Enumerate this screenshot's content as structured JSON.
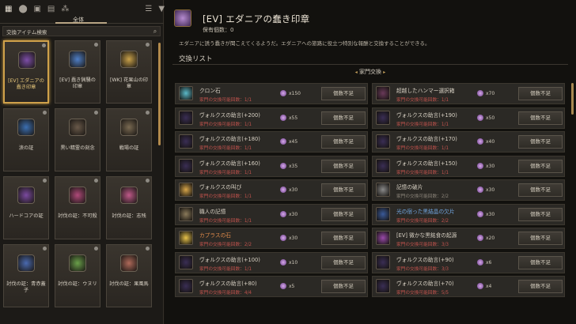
{
  "nav": {
    "icons": [
      "grid-icon",
      "pin-icon",
      "chest-icon",
      "calendar-icon",
      "share-icon",
      "sort-icon",
      "filter-icon"
    ]
  },
  "tabs": {
    "all_label": "全体"
  },
  "search": {
    "placeholder": "交換アイテム検索"
  },
  "items": [
    {
      "name": "[EV] エダニアの\n蠢き印章",
      "color": "#7d4ea8",
      "selected": true
    },
    {
      "name": "[EV] 蠢き猟騒の\n印章",
      "color": "#4f7fc7"
    },
    {
      "name": "[WK] 花果山の印\n章",
      "color": "#caa24a"
    },
    {
      "name": "涙の証",
      "color": "#3b6fb2"
    },
    {
      "name": "黒い精霊の刻念",
      "color": "#6a5a4a"
    },
    {
      "name": "戦場の証",
      "color": "#7a6a52"
    },
    {
      "name": "ハードコアの証",
      "color": "#7b4aa0"
    },
    {
      "name": "討伐の証：不可殺",
      "color": "#b04a7a"
    },
    {
      "name": "討伐の証：志残",
      "color": "#c05a8a"
    },
    {
      "name": "討伐の証：青赤蓋\n子",
      "color": "#4a6ab0"
    },
    {
      "name": "討伐の証：ウヌリ",
      "color": "#6aa04a"
    },
    {
      "name": "討伐の証：果風馬",
      "color": "#b06a5a"
    }
  ],
  "detail": {
    "title": "[EV] エダニアの蠢き印章",
    "owned": "保有個数：0",
    "description": "エダニアに誘う蠢きが聞こえてくるようだ。エダニアへの旅路に役立つ特別な報酬と交換することができる。",
    "list_title": "交換リスト",
    "category": "家門交換",
    "rows_left": [
      {
        "name": "クロン石",
        "limit": "家門の交換可能回数：1/1",
        "cost": "x150",
        "button": "個数不足",
        "color": "#5ab9c9"
      },
      {
        "name": "ヴォルクスの助言(+200)",
        "limit": "家門の交換可能回数：1/1",
        "cost": "x55",
        "button": "個数不足",
        "color": "#3a2e55"
      },
      {
        "name": "ヴォルクスの助言(+180)",
        "limit": "家門の交換可能回数：1/1",
        "cost": "x45",
        "button": "個数不足",
        "color": "#3a2e55"
      },
      {
        "name": "ヴォルクスの助言(+160)",
        "limit": "家門の交換可能回数：1/1",
        "cost": "x35",
        "button": "個数不足",
        "color": "#3a2e55"
      },
      {
        "name": "ヴォルクスの叫び",
        "limit": "家門の交換可能回数：1/1",
        "cost": "x30",
        "button": "個数不足",
        "color": "#d8a64a"
      },
      {
        "name": "職人の記憶",
        "limit": "家門の交換可能回数：1/1",
        "cost": "x30",
        "button": "個数不足",
        "color": "#8a7a5a"
      },
      {
        "name": "カプラスの石",
        "limit": "家門の交換可能回数：2/2",
        "cost": "x30",
        "button": "個数不足",
        "color": "#e7c24a",
        "style": "orange"
      },
      {
        "name": "ヴォルクスの助言(+100)",
        "limit": "家門の交換可能回数：1/1",
        "cost": "x10",
        "button": "個数不足",
        "color": "#3a2e55"
      },
      {
        "name": "ヴォルクスの助言(+80)",
        "limit": "家門の交換可能回数：4/4",
        "cost": "x5",
        "button": "個数不足",
        "color": "#3a2e55"
      }
    ],
    "rows_right": [
      {
        "name": "超越したハンマー選択箱",
        "limit": "家門の交換可能回数：1/1",
        "cost": "x70",
        "button": "個数不足",
        "color": "#6a3a5a"
      },
      {
        "name": "ヴォルクスの助言(+190)",
        "limit": "家門の交換可能回数：1/1",
        "cost": "x50",
        "button": "個数不足",
        "color": "#3a2e55"
      },
      {
        "name": "ヴォルクスの助言(+170)",
        "limit": "家門の交換可能回数：1/1",
        "cost": "x40",
        "button": "個数不足",
        "color": "#3a2e55"
      },
      {
        "name": "ヴォルクスの助言(+150)",
        "limit": "家門の交換可能回数：1/1",
        "cost": "x30",
        "button": "個数不足",
        "color": "#3a2e55"
      },
      {
        "name": "記憶の破片",
        "limit": "家門の交換可能回数：2/2",
        "cost": "x30",
        "button": "個数不足",
        "color": "#8a8a8a",
        "limit_style": "grey"
      },
      {
        "name": "光の宿った黒結晶の欠片",
        "limit": "家門の交換可能回数：2/2",
        "cost": "x30",
        "button": "個数不足",
        "color": "#3a5a9a",
        "style": "blue"
      },
      {
        "name": "[EV] 微かな黒銘食の起源",
        "limit": "家門の交換可能回数：3/3",
        "cost": "x20",
        "button": "個数不足",
        "color": "#9a4aaa"
      },
      {
        "name": "ヴォルクスの助言(+90)",
        "limit": "家門の交換可能回数：3/3",
        "cost": "x6",
        "button": "個数不足",
        "color": "#3a2e55"
      },
      {
        "name": "ヴォルクスの助言(+70)",
        "limit": "家門の交換可能回数：5/5",
        "cost": "x4",
        "button": "個数不足",
        "color": "#3a2e55"
      }
    ]
  }
}
